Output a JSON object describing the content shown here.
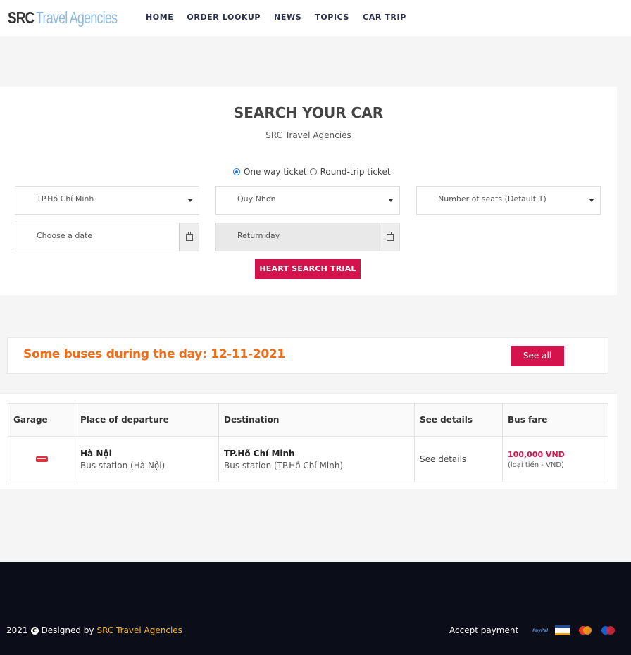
{
  "header": {
    "logo_src": "SRC",
    "logo_rest": "Travel Agencies",
    "nav": [
      "HOME",
      "ORDER LOOKUP",
      "NEWS",
      "TOPICS",
      "CAR TRIP"
    ]
  },
  "search": {
    "title": "SEARCH YOUR CAR",
    "subtitle": "SRC Travel Agencies",
    "one_way_label": "One way ticket",
    "round_trip_label": "Round-trip ticket",
    "from_value": "TP.Hồ Chí Minh",
    "to_value": "Quy Nhơn",
    "seats_placeholder": "Number of seats (Default 1)",
    "date_placeholder": "Choose a date",
    "return_placeholder": "Return day",
    "button_label": "HEART SEARCH TRIAL"
  },
  "buses": {
    "title": "Some buses during the day: 12-11-2021",
    "see_all_label": "See all"
  },
  "table": {
    "headers": [
      "Garage",
      "Place of departure",
      "Destination",
      "See details",
      "Bus fare"
    ],
    "rows": [
      {
        "departure_city": "Hà Nội",
        "departure_station": "Bus station (Hà Nội)",
        "destination_city": "TP.Hồ Chí Minh",
        "destination_station": "Bus station (TP.Hồ Chí Minh)",
        "details_link": "See details",
        "fare": "100,000 VND",
        "fare_note": "(loại tiền - VND)"
      }
    ]
  },
  "footer": {
    "year": "2021",
    "designed_by": "Designed by",
    "brand": "SRC Travel Agencies",
    "accept_payment": "Accept payment",
    "paypal_text": "PayPal"
  },
  "colors": {
    "accent": "#d4124b",
    "orange_title": "#f06d1a",
    "footer_bg": "#0b0d18",
    "footer_brand": "#f7b928"
  }
}
